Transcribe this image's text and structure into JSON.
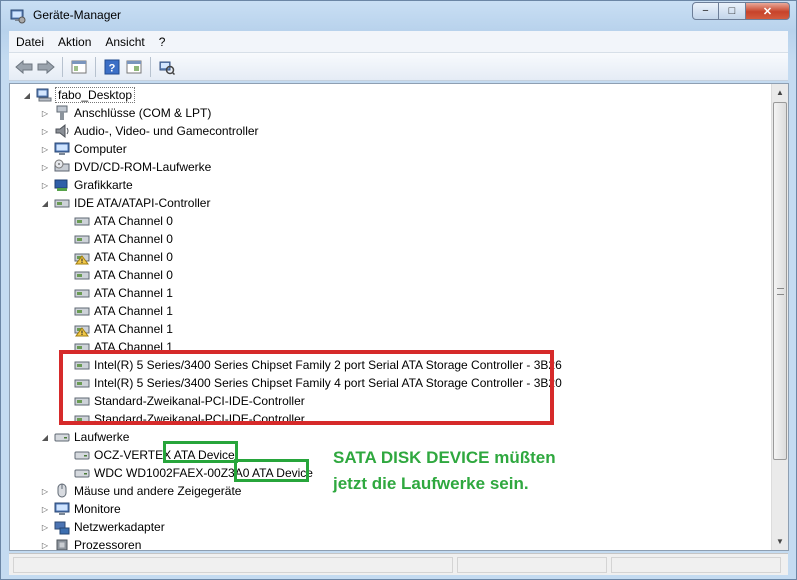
{
  "window": {
    "title": "Geräte-Manager",
    "min": "−",
    "max": "□",
    "close": "✕"
  },
  "menu": [
    "Datei",
    "Aktion",
    "Ansicht",
    "?"
  ],
  "toolbar_icons": [
    "back-arrow-icon",
    "forward-arrow-icon",
    "console-tree-icon",
    "help-icon",
    "properties-icon",
    "scan-hardware-icon"
  ],
  "tree": {
    "root": "fabo_Desktop",
    "categories": [
      {
        "label": "Anschlüsse (COM & LPT)",
        "expanded": false,
        "icon": "port-icon"
      },
      {
        "label": "Audio-, Video- und Gamecontroller",
        "expanded": false,
        "icon": "speaker-icon"
      },
      {
        "label": "Computer",
        "expanded": false,
        "icon": "monitor-icon"
      },
      {
        "label": "DVD/CD-ROM-Laufwerke",
        "expanded": false,
        "icon": "optical-drive-icon"
      },
      {
        "label": "Grafikkarte",
        "expanded": false,
        "icon": "display-adapter-icon"
      },
      {
        "label": "IDE ATA/ATAPI-Controller",
        "expanded": true,
        "icon": "controller-icon"
      }
    ],
    "ide_children": [
      {
        "label": "ATA Channel 0",
        "warning": false
      },
      {
        "label": "ATA Channel 0",
        "warning": false
      },
      {
        "label": "ATA Channel 0",
        "warning": true
      },
      {
        "label": "ATA Channel 0",
        "warning": false
      },
      {
        "label": "ATA Channel 1",
        "warning": false
      },
      {
        "label": "ATA Channel 1",
        "warning": false
      },
      {
        "label": "ATA Channel 1",
        "warning": true
      },
      {
        "label": "ATA Channel 1",
        "warning": false
      },
      {
        "label": "Intel(R) 5 Series/3400 Series Chipset Family 2 port Serial ATA Storage Controller - 3B26",
        "warning": false
      },
      {
        "label": "Intel(R) 5 Series/3400 Series Chipset Family 4 port Serial ATA Storage Controller - 3B20",
        "warning": false
      },
      {
        "label": "Standard-Zweikanal-PCI-IDE-Controller",
        "warning": false
      },
      {
        "label": "Standard-Zweikanal-PCI-IDE-Controller",
        "warning": false
      }
    ],
    "drives_category": "Laufwerke",
    "drives": [
      {
        "label": "OCZ-VERTEX ATA Device"
      },
      {
        "label": "WDC WD1002FAEX-00Z3A0 ATA Device"
      }
    ],
    "after_categories": [
      {
        "label": "Mäuse und andere Zeigegeräte",
        "icon": "mouse-icon"
      },
      {
        "label": "Monitore",
        "icon": "monitor-icon"
      },
      {
        "label": "Netzwerkadapter",
        "icon": "network-adapter-icon"
      },
      {
        "label": "Prozessoren",
        "icon": "processor-icon"
      }
    ]
  },
  "annotation": {
    "line1": "SATA DISK DEVICE müßten",
    "line2": "jetzt die Laufwerke sein.",
    "highlight_red": "#d62a2a",
    "highlight_green": "#27a53b",
    "text_color": "#2fa83f"
  }
}
